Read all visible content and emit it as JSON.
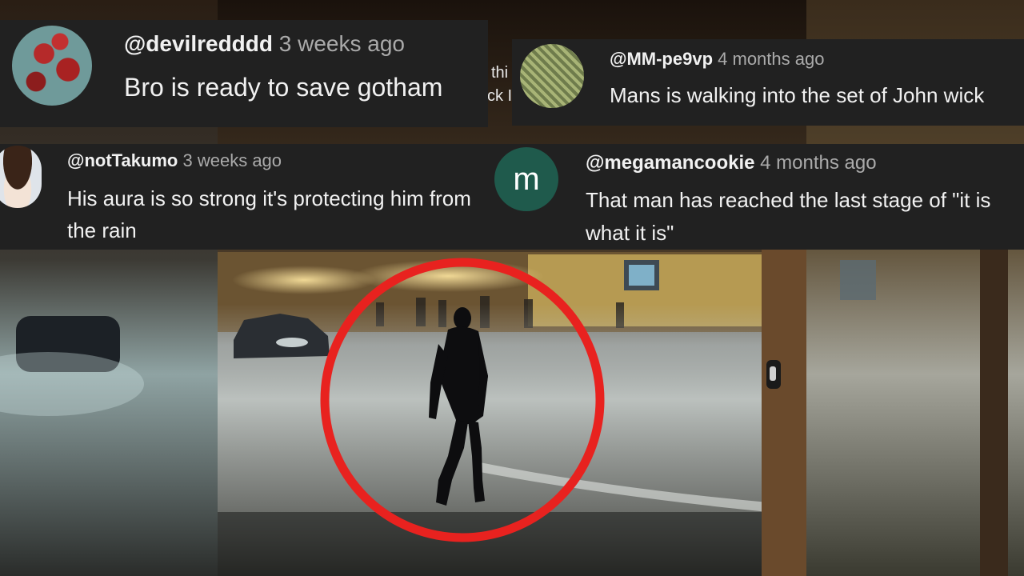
{
  "comments": [
    {
      "handle": "@devilredddd",
      "time": "3 weeks ago",
      "text": "Bro is ready to save gotham",
      "avatar": "red-roses-icon"
    },
    {
      "handle": "@MM-pe9vp",
      "time": "4 months ago",
      "text": "Mans is walking into the set of John wick",
      "avatar": "green-pattern-icon"
    },
    {
      "handle": "@notTakumo",
      "time": "3 weeks ago",
      "text": "His aura is so strong it's protecting him from the rain",
      "avatar": "anime-character-icon"
    },
    {
      "handle": "@megamancookie",
      "time": "4 months ago",
      "text": "That man has reached the last stage of \"it is what it is\"",
      "avatar_letter": "m"
    }
  ],
  "background_sign_text": "thi ck I",
  "colors": {
    "comment_bg": "#212121",
    "handle": "#f1f1f1",
    "time": "#aaaaaa",
    "circle": "#e8221f",
    "letter_avatar": "#1f5a4c"
  }
}
